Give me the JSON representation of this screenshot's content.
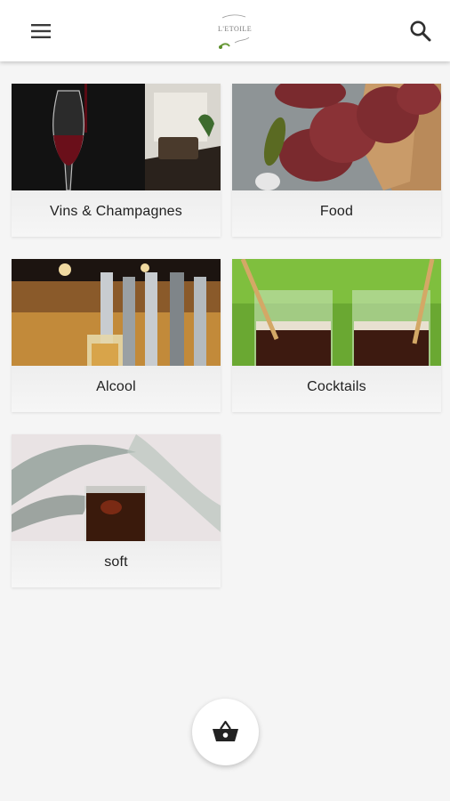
{
  "appbar": {
    "logo_text": "L'ETOILE",
    "menu_icon": "hamburger-menu-icon",
    "search_icon": "search-icon"
  },
  "categories": [
    {
      "label": "Vins & Champagnes",
      "image": "red-wine-glass"
    },
    {
      "label": "Food",
      "image": "sausage-salami"
    },
    {
      "label": "Alcool",
      "image": "beer-taps"
    },
    {
      "label": "Cocktails",
      "image": "cola-glasses-with-straws"
    },
    {
      "label": "soft",
      "image": "cola-glass-with-palm-leaf"
    }
  ],
  "fab": {
    "icon": "shopping-basket-icon"
  },
  "colors": {
    "background": "#f5f5f5",
    "appbar": "#ffffff",
    "text": "#1f1f1f",
    "icon": "#3a3a3a"
  }
}
